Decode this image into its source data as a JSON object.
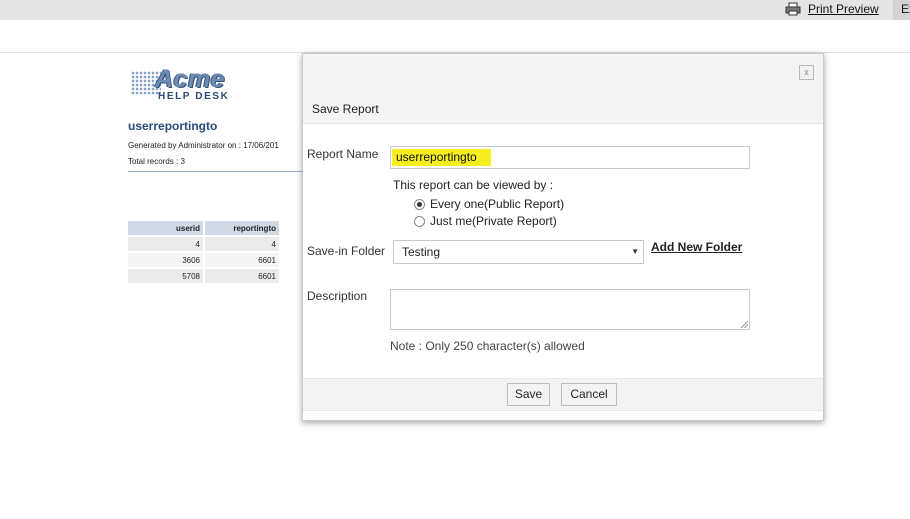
{
  "toolbar": {
    "print_preview_label": "Print Preview",
    "export_label": "Ex"
  },
  "report": {
    "logo_text": "Acme",
    "logo_subtext": "HELP DESK",
    "title": "userreportingto",
    "generated_by": "Generated by Administrator  on : 17/06/201",
    "total_records": "Total records : 3",
    "columns": [
      "userid",
      "reportingto"
    ],
    "rows": [
      [
        "4",
        "4"
      ],
      [
        "3606",
        "6601"
      ],
      [
        "5708",
        "6601"
      ]
    ]
  },
  "dialog": {
    "close_label": "x",
    "title": "Save Report",
    "report_name_label": "Report Name",
    "report_name_value": "userreportingto",
    "viewed_by_label": "This report can be viewed by :",
    "option_public_strong": "Every one",
    "option_public_note": " (Public Report)",
    "option_private_strong": "Just me",
    "option_private_note": "(Private Report)",
    "selected_visibility": "public",
    "save_in_folder_label": "Save-in Folder",
    "folder_selected": "Testing",
    "add_folder_label": "Add New Folder",
    "description_label": "Description",
    "description_value": "",
    "note": "Note : Only 250 character(s) allowed",
    "save_label": "Save",
    "cancel_label": "Cancel"
  },
  "colors": {
    "highlight": "#f6ee1e",
    "table_header": "#d0dae7",
    "logo_blue": "#6d8cb5"
  }
}
